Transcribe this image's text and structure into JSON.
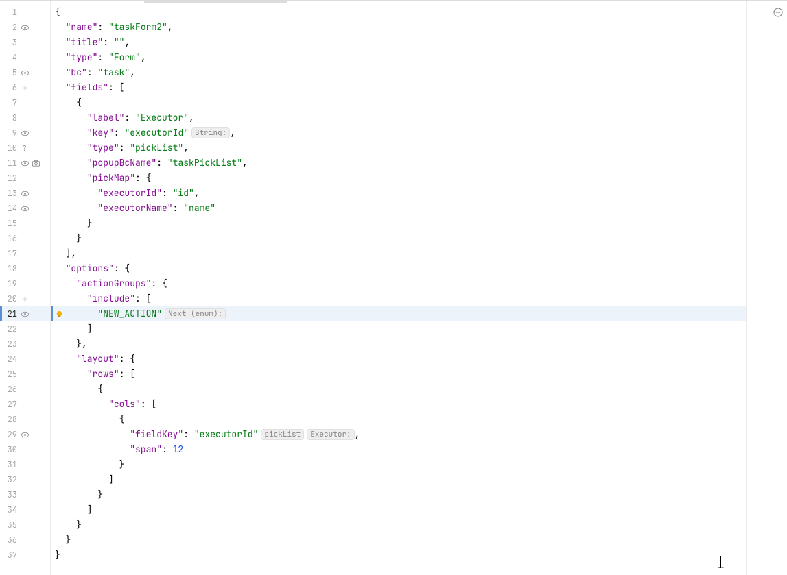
{
  "gutter": {
    "rows": [
      {
        "n": 1,
        "icons": []
      },
      {
        "n": 2,
        "icons": [
          "eye"
        ]
      },
      {
        "n": 3,
        "icons": []
      },
      {
        "n": 4,
        "icons": []
      },
      {
        "n": 5,
        "icons": [
          "eye"
        ]
      },
      {
        "n": 6,
        "icons": [
          "plus"
        ]
      },
      {
        "n": 7,
        "icons": []
      },
      {
        "n": 8,
        "icons": []
      },
      {
        "n": 9,
        "icons": [
          "eye"
        ]
      },
      {
        "n": 10,
        "icons": [
          "question"
        ]
      },
      {
        "n": 11,
        "icons": [
          "eye",
          "camera"
        ]
      },
      {
        "n": 12,
        "icons": []
      },
      {
        "n": 13,
        "icons": [
          "eye"
        ]
      },
      {
        "n": 14,
        "icons": [
          "eye"
        ]
      },
      {
        "n": 15,
        "icons": []
      },
      {
        "n": 16,
        "icons": []
      },
      {
        "n": 17,
        "icons": []
      },
      {
        "n": 18,
        "icons": []
      },
      {
        "n": 19,
        "icons": []
      },
      {
        "n": 20,
        "icons": [
          "plus"
        ]
      },
      {
        "n": 21,
        "icons": [
          "eye"
        ],
        "active": true
      },
      {
        "n": 22,
        "icons": []
      },
      {
        "n": 23,
        "icons": []
      },
      {
        "n": 24,
        "icons": []
      },
      {
        "n": 25,
        "icons": []
      },
      {
        "n": 26,
        "icons": []
      },
      {
        "n": 27,
        "icons": []
      },
      {
        "n": 28,
        "icons": []
      },
      {
        "n": 29,
        "icons": [
          "eye"
        ]
      },
      {
        "n": 30,
        "icons": []
      },
      {
        "n": 31,
        "icons": []
      },
      {
        "n": 32,
        "icons": []
      },
      {
        "n": 33,
        "icons": []
      },
      {
        "n": 34,
        "icons": []
      },
      {
        "n": 35,
        "icons": []
      },
      {
        "n": 36,
        "icons": []
      },
      {
        "n": 37,
        "icons": []
      }
    ]
  },
  "inlays": {
    "line9": "String:",
    "line21": "Next (enum):",
    "line29a": "pickList",
    "line29b": "Executor:"
  },
  "code": {
    "l1": "{",
    "l2": {
      "indent": "  ",
      "k": "\"name\"",
      "sep": ": ",
      "v": "\"taskForm2\"",
      "tail": ","
    },
    "l3": {
      "indent": "  ",
      "k": "\"title\"",
      "sep": ": ",
      "v": "\"\"",
      "tail": ","
    },
    "l4": {
      "indent": "  ",
      "k": "\"type\"",
      "sep": ": ",
      "v": "\"Form\"",
      "tail": ","
    },
    "l5": {
      "indent": "  ",
      "k": "\"bc\"",
      "sep": ": ",
      "v": "\"task\"",
      "tail": ","
    },
    "l6": {
      "indent": "  ",
      "k": "\"fields\"",
      "sep": ": ",
      "tail": "["
    },
    "l7": "    {",
    "l8": {
      "indent": "      ",
      "k": "\"label\"",
      "sep": ": ",
      "v": "\"Executor\"",
      "tail": ","
    },
    "l9": {
      "indent": "      ",
      "k": "\"key\"",
      "sep": ": ",
      "v": "\"executorId\"",
      "tail": ","
    },
    "l10": {
      "indent": "      ",
      "k": "\"type\"",
      "sep": ": ",
      "v": "\"pickList\"",
      "tail": ","
    },
    "l11": {
      "indent": "      ",
      "k": "\"popupBcName\"",
      "sep": ": ",
      "v": "\"taskPickList\"",
      "tail": ","
    },
    "l12": {
      "indent": "      ",
      "k": "\"pickMap\"",
      "sep": ": ",
      "tail": "{"
    },
    "l13": {
      "indent": "        ",
      "k": "\"executorId\"",
      "sep": ": ",
      "v": "\"id\"",
      "tail": ","
    },
    "l14": {
      "indent": "        ",
      "k": "\"executorName\"",
      "sep": ": ",
      "v": "\"name\"",
      "tail": ""
    },
    "l15": "      }",
    "l16": "    }",
    "l17": "  ],",
    "l18": {
      "indent": "  ",
      "k": "\"options\"",
      "sep": ": ",
      "tail": "{"
    },
    "l19": {
      "indent": "    ",
      "k": "\"actionGroups\"",
      "sep": ": ",
      "tail": "{"
    },
    "l20": {
      "indent": "      ",
      "k": "\"include\"",
      "sep": ": ",
      "tail": "["
    },
    "l21": {
      "indent": "        ",
      "v": "\"NEW_ACTION\"",
      "tail": ""
    },
    "l22": "      ]",
    "l23": "    },",
    "l24": {
      "indent": "    ",
      "k": "\"layout\"",
      "sep": ": ",
      "tail": "{"
    },
    "l25": {
      "indent": "      ",
      "k": "\"rows\"",
      "sep": ": ",
      "tail": "["
    },
    "l26": "        {",
    "l27": {
      "indent": "          ",
      "k": "\"cols\"",
      "sep": ": ",
      "tail": "["
    },
    "l28": "            {",
    "l29": {
      "indent": "              ",
      "k": "\"fieldKey\"",
      "sep": ": ",
      "v": "\"executorId\"",
      "tail": ","
    },
    "l30": {
      "indent": "              ",
      "k": "\"span\"",
      "sep": ": ",
      "num": "12",
      "tail": ""
    },
    "l31": "            }",
    "l32": "          ]",
    "l33": "        }",
    "l34": "      ]",
    "l35": "    }",
    "l36": "  }",
    "l37": "}"
  }
}
